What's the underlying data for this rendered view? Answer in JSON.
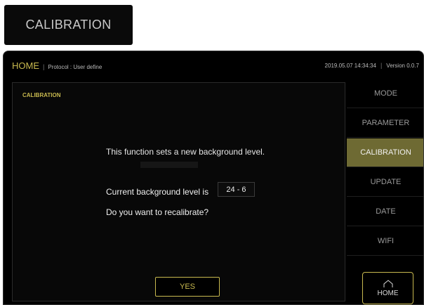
{
  "title_card": {
    "label": "CALIBRATION"
  },
  "header": {
    "home": "HOME",
    "separator": "|",
    "protocol": "Protocol : User define",
    "datetime": "2019.05.07 14:34:34",
    "version": "Version 0.0.7"
  },
  "content": {
    "section_title": "CALIBRATION",
    "message": "This function sets a new background level.",
    "level_label": "Current background level is",
    "level_value": "24 - 6",
    "question": "Do you want to recalibrate?",
    "yes_label": "YES"
  },
  "sidebar": {
    "items": [
      {
        "label": "MODE",
        "active": false
      },
      {
        "label": "PARAMETER",
        "active": false
      },
      {
        "label": "CALIBRATION",
        "active": true
      },
      {
        "label": "UPDATE",
        "active": false
      },
      {
        "label": "DATE",
        "active": false
      },
      {
        "label": "WIFI",
        "active": false
      }
    ],
    "home_label": "HOME",
    "home_icon": "home-icon"
  },
  "colors": {
    "accent": "#c8b94f",
    "active_menu": "#6e6a33",
    "background": "#000000"
  }
}
